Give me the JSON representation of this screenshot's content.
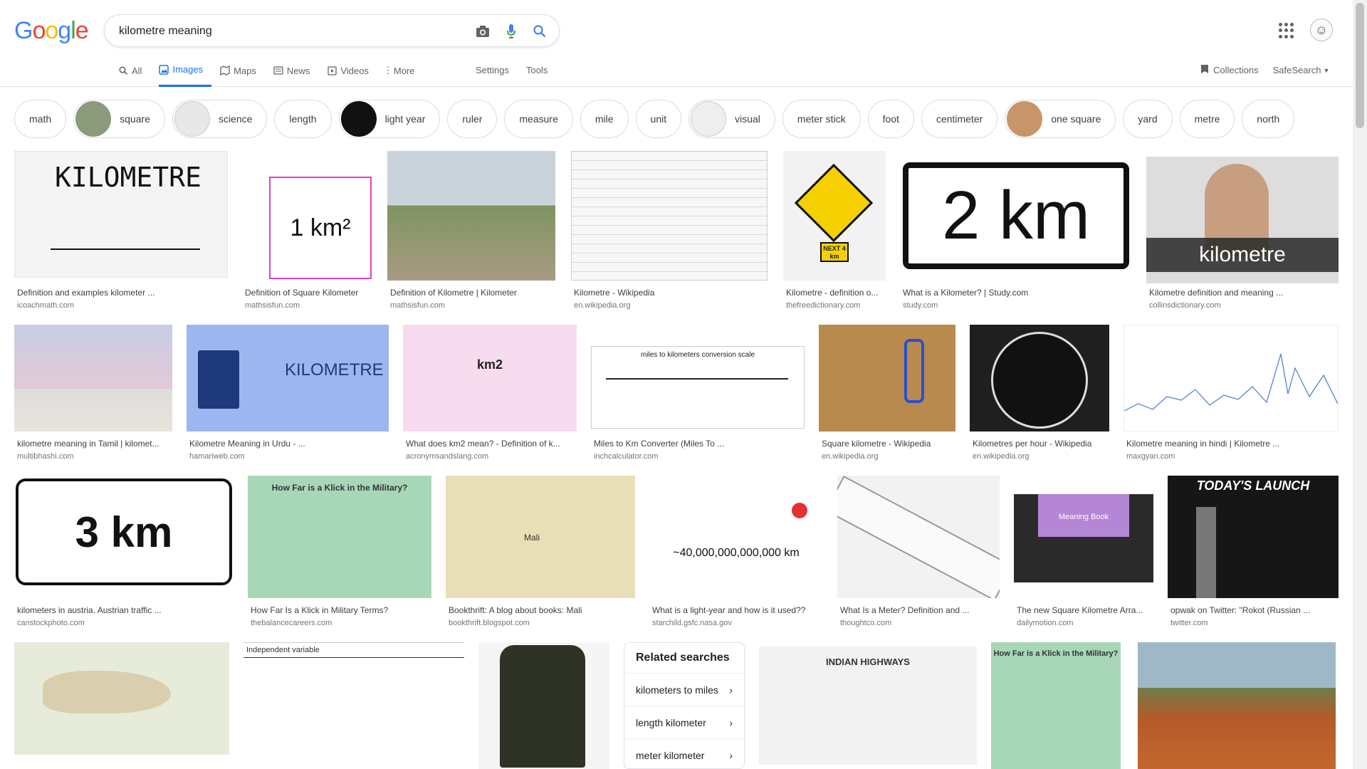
{
  "search": {
    "query": "kilometre meaning"
  },
  "logo": {
    "letters": [
      "G",
      "o",
      "o",
      "g",
      "l",
      "e"
    ],
    "colors": [
      "#4285F4",
      "#EA4335",
      "#FBBC05",
      "#4285F4",
      "#34A853",
      "#EA4335"
    ]
  },
  "tabs": [
    {
      "label": "All",
      "icon": "search-icon",
      "active": false
    },
    {
      "label": "Images",
      "icon": "image-icon",
      "active": true
    },
    {
      "label": "Maps",
      "icon": "map-icon",
      "active": false
    },
    {
      "label": "News",
      "icon": "news-icon",
      "active": false
    },
    {
      "label": "Videos",
      "icon": "video-icon",
      "active": false
    },
    {
      "label": "More",
      "icon": "more-vert-icon",
      "active": false
    }
  ],
  "tools": {
    "settings": "Settings",
    "tools": "Tools"
  },
  "right": {
    "collections": "Collections",
    "safesearch": "SafeSearch"
  },
  "accent": "#1a73e8",
  "chips": [
    {
      "label": "math",
      "thumb": false
    },
    {
      "label": "square",
      "thumb": true,
      "color": "#8b9a7a"
    },
    {
      "label": "science",
      "thumb": true,
      "color": "#e8e8e8"
    },
    {
      "label": "length",
      "thumb": false
    },
    {
      "label": "light year",
      "thumb": true,
      "color": "#111111"
    },
    {
      "label": "ruler",
      "thumb": false
    },
    {
      "label": "measure",
      "thumb": false
    },
    {
      "label": "mile",
      "thumb": false
    },
    {
      "label": "unit",
      "thumb": false
    },
    {
      "label": "visual",
      "thumb": true,
      "color": "#eeeeee"
    },
    {
      "label": "meter stick",
      "thumb": false
    },
    {
      "label": "foot",
      "thumb": false
    },
    {
      "label": "centimeter",
      "thumb": false
    },
    {
      "label": "one square",
      "thumb": true,
      "color": "#c8956b"
    },
    {
      "label": "yard",
      "thumb": false
    },
    {
      "label": "metre",
      "thumb": false
    },
    {
      "label": "north",
      "thumb": false
    }
  ],
  "results": [
    {
      "caption": "Definition and examples kilometer ...",
      "source": "icoachmath.com",
      "bg": "#f4f4f4",
      "text": "KILOMETRE",
      "textColor": "#111"
    },
    {
      "caption": "Definition of Square Kilometer",
      "source": "mathsisfun.com",
      "bg": "#ffffff",
      "text": "1 km²",
      "textColor": "#111"
    },
    {
      "caption": "Definition of Kilometre | Kilometer",
      "source": "mathsisfun.com",
      "bg": "#9aa68a",
      "text": "",
      "textColor": "#fff"
    },
    {
      "caption": "Kilometre - Wikipedia",
      "source": "en.wikipedia.org",
      "bg": "#f7f7f7",
      "text": "",
      "textColor": "#333"
    },
    {
      "caption": "Kilometre - definition o...",
      "source": "thefreedictionary.com",
      "bg": "#f2f2f2",
      "text": "NEXT 4 km",
      "textColor": "#111"
    },
    {
      "caption": "What is a Kilometer? | Study.com",
      "source": "study.com",
      "bg": "#ffffff",
      "text": "2 km",
      "textColor": "#111"
    },
    {
      "caption": "Kilometre definition and meaning ...",
      "source": "collinsdictionary.com",
      "bg": "#dddddd",
      "text": "kilometre",
      "textColor": "#fff"
    },
    {
      "caption": "kilometre meaning in Tamil | kilomet...",
      "source": "multibhashi.com",
      "bg": "#b9c3d6",
      "text": "",
      "textColor": "#fff"
    },
    {
      "caption": "Kilometre Meaning in Urdu - ...",
      "source": "hamariweb.com",
      "bg": "#9db6ef",
      "text": "KILOMETRE",
      "textColor": "#1d3b7a"
    },
    {
      "caption": "What does km2 mean? - Definition of k...",
      "source": "acronymsandslang.com",
      "bg": "#f6dcee",
      "text": "km2",
      "textColor": "#222"
    },
    {
      "caption": "Miles to Km Converter (Miles To ...",
      "source": "inchcalculator.com",
      "bg": "#ffffff",
      "text": "miles to kilometers conversion scale",
      "textColor": "#222"
    },
    {
      "caption": "Square kilometre - Wikipedia",
      "source": "en.wikipedia.org",
      "bg": "#b98a4d",
      "text": "",
      "textColor": "#fff"
    },
    {
      "caption": "Kilometres per hour - Wikipedia",
      "source": "en.wikipedia.org",
      "bg": "#1f1f1f",
      "text": "",
      "textColor": "#fff"
    },
    {
      "caption": "Kilometre meaning in hindi | Kilometre ...",
      "source": "maxgyan.com",
      "bg": "#ffffff",
      "text": "",
      "textColor": "#4a7bd4"
    },
    {
      "caption": "kilometers in austria. Austrian traffic ...",
      "source": "canstockphoto.com",
      "bg": "#ffffff",
      "text": "3 km",
      "textColor": "#111"
    },
    {
      "caption": "How Far Is a Klick in Military Terms?",
      "source": "thebalancecareers.com",
      "bg": "#a8d7b8",
      "text": "How Far is a Klick in the Military?",
      "textColor": "#333"
    },
    {
      "caption": "Bookthrift: A blog about books: Mali",
      "source": "bookthrift.blogspot.com",
      "bg": "#e9dfb6",
      "text": "Mali",
      "textColor": "#333"
    },
    {
      "caption": "What is a light-year and how is it used??",
      "source": "starchild.gsfc.nasa.gov",
      "bg": "#ffffff",
      "text": "~40,000,000,000,000 km",
      "textColor": "#111"
    },
    {
      "caption": "What Is a Meter? Definition and ...",
      "source": "thoughtco.com",
      "bg": "#f2f2f2",
      "text": "",
      "textColor": "#111"
    },
    {
      "caption": "The new Square Kilometre Arra...",
      "source": "dailymotion.com",
      "bg": "#2a2a2a",
      "text": "Meaning Book",
      "textColor": "#fff"
    },
    {
      "caption": "opwak on Twitter: \"Rokot (Russian ...",
      "source": "twitter.com",
      "bg": "#161616",
      "text": "TODAY'S LAUNCH",
      "textColor": "#fff"
    },
    {
      "caption": "",
      "source": "",
      "bg": "#e6ecd9",
      "text": "",
      "textColor": "#333"
    },
    {
      "caption": "",
      "source": "",
      "bg": "#ffffff",
      "text": "Independent variable",
      "textColor": "#333"
    },
    {
      "caption": "",
      "source": "",
      "bg": "#f5f5f5",
      "text": "",
      "textColor": "#333"
    },
    {
      "caption": "",
      "source": "",
      "bg": "#f2f2f2",
      "text": "INDIAN HIGHWAYS",
      "textColor": "#333"
    },
    {
      "caption": "",
      "source": "",
      "bg": "#a8d7b8",
      "text": "How Far is a Klick in the Military?",
      "textColor": "#333"
    },
    {
      "caption": "",
      "source": "",
      "bg": "#b45a2a",
      "text": "",
      "textColor": "#fff"
    }
  ],
  "related": {
    "title": "Related searches",
    "items": [
      "kilometers to miles",
      "length kilometer",
      "meter kilometer"
    ]
  }
}
